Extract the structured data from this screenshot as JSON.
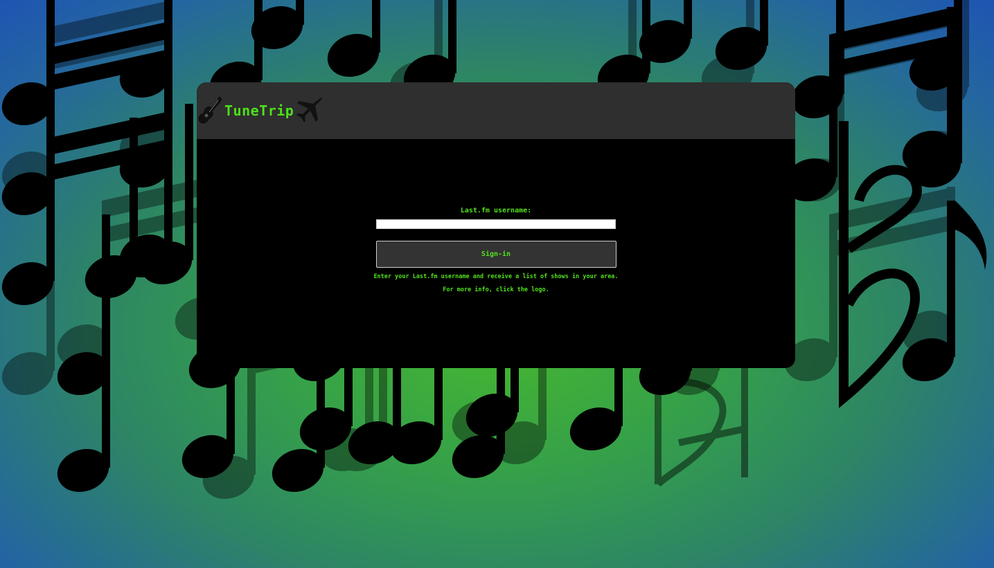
{
  "header": {
    "brand": "TuneTrip",
    "icons": [
      "guitar-icon",
      "airplane-icon"
    ]
  },
  "form": {
    "label": "Last.fm username:",
    "input_value": "",
    "input_placeholder": "",
    "button_label": "Sign-in"
  },
  "help": {
    "line1": "Enter your Last.fm username and receive a list of shows in your area.",
    "line2": "For more info, click the logo."
  },
  "colors": {
    "accent": "#4ee01a",
    "header_bg": "#2f2f2f",
    "card_bg": "#000000",
    "bg_center": "#46b82e",
    "bg_edge": "#1c4fb8"
  }
}
